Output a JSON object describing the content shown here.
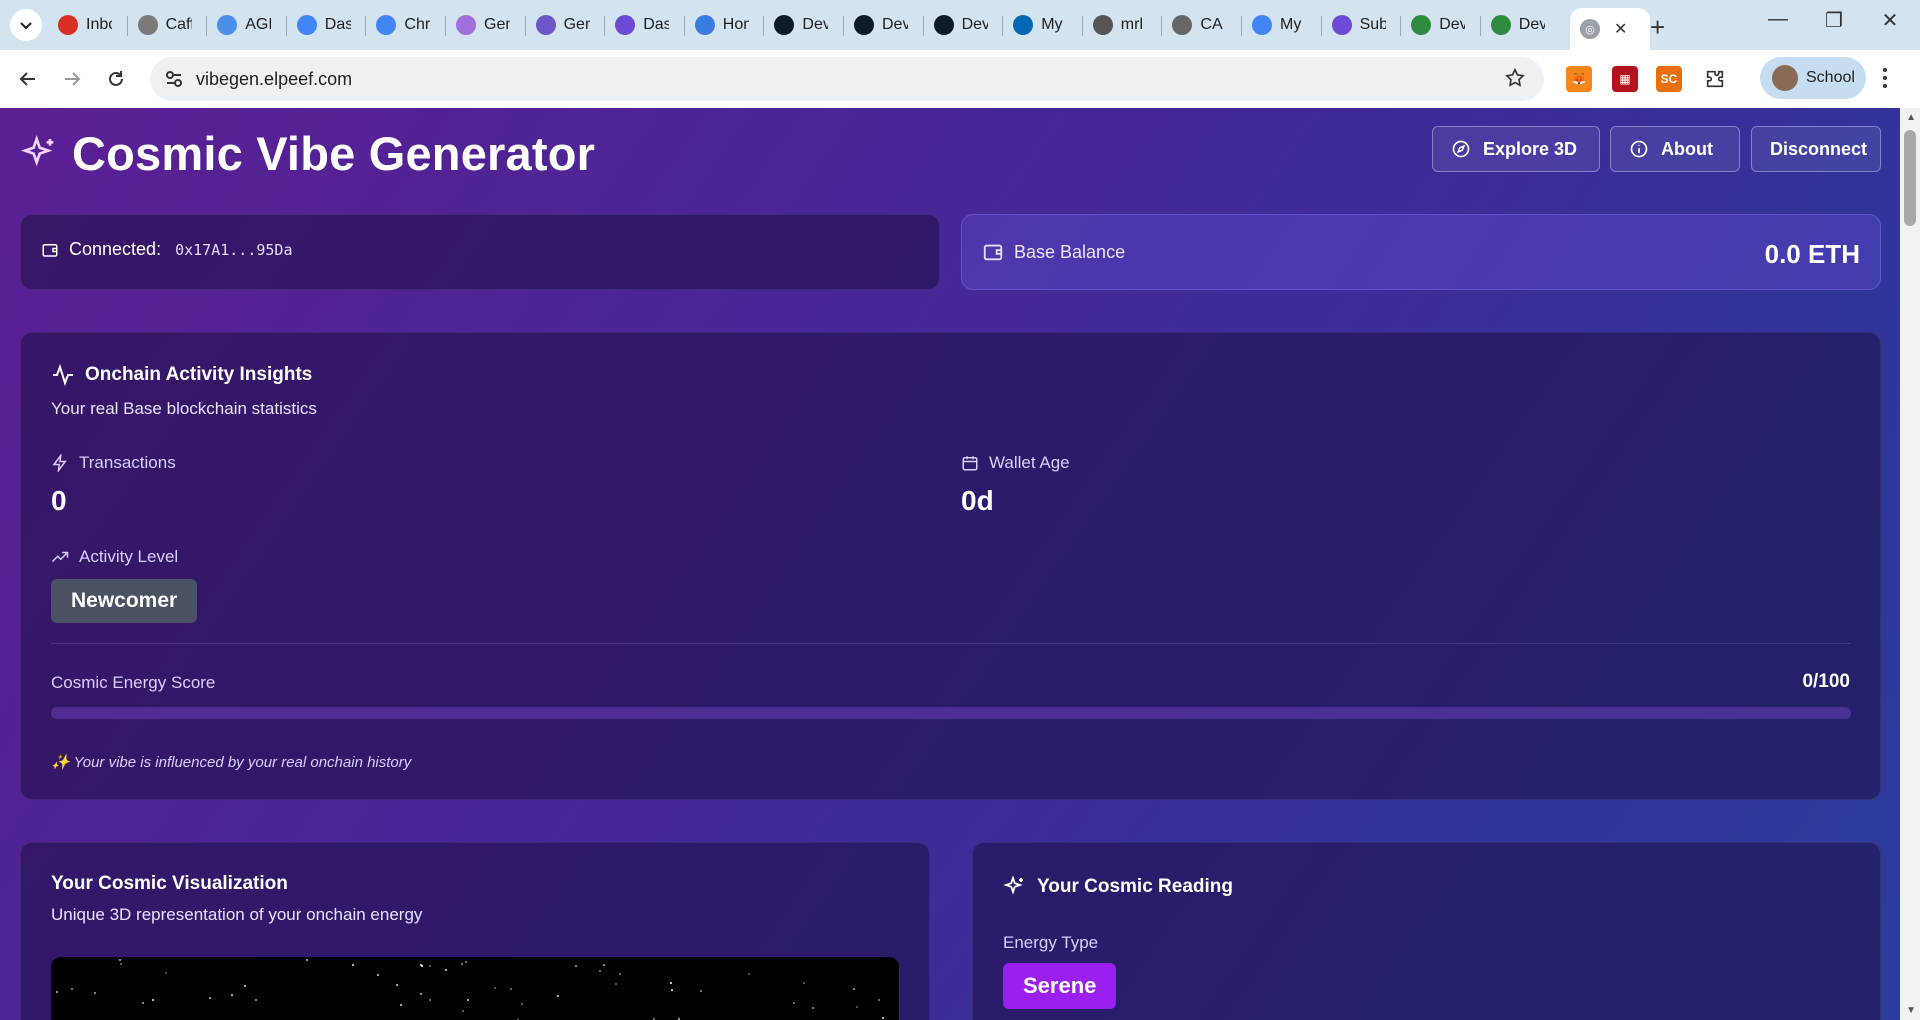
{
  "browser": {
    "tabs": [
      {
        "title": "Inbox",
        "icon": "gmail-icon",
        "color": "#d93025"
      },
      {
        "title": "Caffeine",
        "icon": "web-icon",
        "color": "#7a7a7a"
      },
      {
        "title": "AGI",
        "icon": "web-icon",
        "color": "#4b8fe8"
      },
      {
        "title": "Dash",
        "icon": "google-icon",
        "color": "#4285f4"
      },
      {
        "title": "Chrome",
        "icon": "google-icon",
        "color": "#4285f4"
      },
      {
        "title": "Gemini",
        "icon": "gemini-icon",
        "color": "#a16ee0"
      },
      {
        "title": "Gen",
        "icon": "app-icon",
        "color": "#6b55c7"
      },
      {
        "title": "Dash",
        "icon": "hashnode-icon",
        "color": "#6d4ad6"
      },
      {
        "title": "Home",
        "icon": "web-icon",
        "color": "#3a7be0"
      },
      {
        "title": "Dev",
        "icon": "d-icon",
        "color": "#0e1a2b"
      },
      {
        "title": "Dev",
        "icon": "d-icon",
        "color": "#0e1a2b"
      },
      {
        "title": "Dev",
        "icon": "d-icon",
        "color": "#0e1a2b"
      },
      {
        "title": "My",
        "icon": "intel-icon",
        "color": "#0068b5"
      },
      {
        "title": "mrl",
        "icon": "github-icon",
        "color": "#555555"
      },
      {
        "title": "CA",
        "icon": "openai-icon",
        "color": "#666666"
      },
      {
        "title": "My",
        "icon": "google-icon",
        "color": "#4285f4"
      },
      {
        "title": "Sub",
        "icon": "hashnode-icon",
        "color": "#6d4ad6"
      },
      {
        "title": "Dev",
        "icon": "leaf-icon",
        "color": "#2c8b3f"
      },
      {
        "title": "Dev",
        "icon": "leaf-icon",
        "color": "#2c8b3f"
      }
    ],
    "url": "vibegen.elpeef.com",
    "profile_name": "School"
  },
  "page": {
    "title": "Cosmic Vibe Generator",
    "buttons": {
      "explore": "Explore 3D",
      "about": "About",
      "disconnect": "Disconnect"
    },
    "wallet": {
      "connected_label": "Connected:",
      "address": "0x17A1...95Da"
    },
    "balance": {
      "label": "Base Balance",
      "value": "0.0 ETH"
    },
    "insights": {
      "title": "Onchain Activity Insights",
      "subtitle": "Your real Base blockchain statistics",
      "transactions_label": "Transactions",
      "transactions_value": "0",
      "wallet_age_label": "Wallet Age",
      "wallet_age_value": "0d",
      "activity_label": "Activity Level",
      "activity_value": "Newcomer",
      "energy_label": "Cosmic Energy Score",
      "energy_value": "0/100",
      "energy_fraction": 0,
      "note": "✨ Your vibe is influenced by your real onchain history"
    },
    "visualization": {
      "title": "Your Cosmic Visualization",
      "subtitle": "Unique 3D representation of your onchain energy"
    },
    "reading": {
      "title": "Your Cosmic Reading",
      "energy_type_label": "Energy Type",
      "energy_type_value": "Serene"
    }
  }
}
